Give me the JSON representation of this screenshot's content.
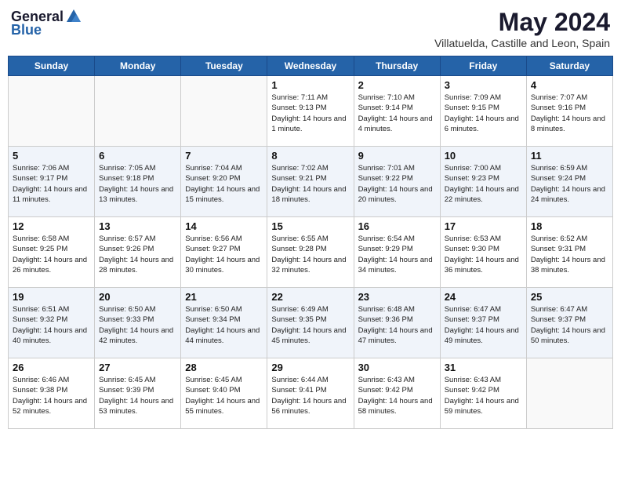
{
  "logo": {
    "general": "General",
    "blue": "Blue"
  },
  "title": "May 2024",
  "location": "Villatuelda, Castille and Leon, Spain",
  "headers": [
    "Sunday",
    "Monday",
    "Tuesday",
    "Wednesday",
    "Thursday",
    "Friday",
    "Saturday"
  ],
  "weeks": [
    [
      {
        "date": "",
        "sunrise": "",
        "sunset": "",
        "daylight": ""
      },
      {
        "date": "",
        "sunrise": "",
        "sunset": "",
        "daylight": ""
      },
      {
        "date": "",
        "sunrise": "",
        "sunset": "",
        "daylight": ""
      },
      {
        "date": "1",
        "sunrise": "Sunrise: 7:11 AM",
        "sunset": "Sunset: 9:13 PM",
        "daylight": "Daylight: 14 hours and 1 minute."
      },
      {
        "date": "2",
        "sunrise": "Sunrise: 7:10 AM",
        "sunset": "Sunset: 9:14 PM",
        "daylight": "Daylight: 14 hours and 4 minutes."
      },
      {
        "date": "3",
        "sunrise": "Sunrise: 7:09 AM",
        "sunset": "Sunset: 9:15 PM",
        "daylight": "Daylight: 14 hours and 6 minutes."
      },
      {
        "date": "4",
        "sunrise": "Sunrise: 7:07 AM",
        "sunset": "Sunset: 9:16 PM",
        "daylight": "Daylight: 14 hours and 8 minutes."
      }
    ],
    [
      {
        "date": "5",
        "sunrise": "Sunrise: 7:06 AM",
        "sunset": "Sunset: 9:17 PM",
        "daylight": "Daylight: 14 hours and 11 minutes."
      },
      {
        "date": "6",
        "sunrise": "Sunrise: 7:05 AM",
        "sunset": "Sunset: 9:18 PM",
        "daylight": "Daylight: 14 hours and 13 minutes."
      },
      {
        "date": "7",
        "sunrise": "Sunrise: 7:04 AM",
        "sunset": "Sunset: 9:20 PM",
        "daylight": "Daylight: 14 hours and 15 minutes."
      },
      {
        "date": "8",
        "sunrise": "Sunrise: 7:02 AM",
        "sunset": "Sunset: 9:21 PM",
        "daylight": "Daylight: 14 hours and 18 minutes."
      },
      {
        "date": "9",
        "sunrise": "Sunrise: 7:01 AM",
        "sunset": "Sunset: 9:22 PM",
        "daylight": "Daylight: 14 hours and 20 minutes."
      },
      {
        "date": "10",
        "sunrise": "Sunrise: 7:00 AM",
        "sunset": "Sunset: 9:23 PM",
        "daylight": "Daylight: 14 hours and 22 minutes."
      },
      {
        "date": "11",
        "sunrise": "Sunrise: 6:59 AM",
        "sunset": "Sunset: 9:24 PM",
        "daylight": "Daylight: 14 hours and 24 minutes."
      }
    ],
    [
      {
        "date": "12",
        "sunrise": "Sunrise: 6:58 AM",
        "sunset": "Sunset: 9:25 PM",
        "daylight": "Daylight: 14 hours and 26 minutes."
      },
      {
        "date": "13",
        "sunrise": "Sunrise: 6:57 AM",
        "sunset": "Sunset: 9:26 PM",
        "daylight": "Daylight: 14 hours and 28 minutes."
      },
      {
        "date": "14",
        "sunrise": "Sunrise: 6:56 AM",
        "sunset": "Sunset: 9:27 PM",
        "daylight": "Daylight: 14 hours and 30 minutes."
      },
      {
        "date": "15",
        "sunrise": "Sunrise: 6:55 AM",
        "sunset": "Sunset: 9:28 PM",
        "daylight": "Daylight: 14 hours and 32 minutes."
      },
      {
        "date": "16",
        "sunrise": "Sunrise: 6:54 AM",
        "sunset": "Sunset: 9:29 PM",
        "daylight": "Daylight: 14 hours and 34 minutes."
      },
      {
        "date": "17",
        "sunrise": "Sunrise: 6:53 AM",
        "sunset": "Sunset: 9:30 PM",
        "daylight": "Daylight: 14 hours and 36 minutes."
      },
      {
        "date": "18",
        "sunrise": "Sunrise: 6:52 AM",
        "sunset": "Sunset: 9:31 PM",
        "daylight": "Daylight: 14 hours and 38 minutes."
      }
    ],
    [
      {
        "date": "19",
        "sunrise": "Sunrise: 6:51 AM",
        "sunset": "Sunset: 9:32 PM",
        "daylight": "Daylight: 14 hours and 40 minutes."
      },
      {
        "date": "20",
        "sunrise": "Sunrise: 6:50 AM",
        "sunset": "Sunset: 9:33 PM",
        "daylight": "Daylight: 14 hours and 42 minutes."
      },
      {
        "date": "21",
        "sunrise": "Sunrise: 6:50 AM",
        "sunset": "Sunset: 9:34 PM",
        "daylight": "Daylight: 14 hours and 44 minutes."
      },
      {
        "date": "22",
        "sunrise": "Sunrise: 6:49 AM",
        "sunset": "Sunset: 9:35 PM",
        "daylight": "Daylight: 14 hours and 45 minutes."
      },
      {
        "date": "23",
        "sunrise": "Sunrise: 6:48 AM",
        "sunset": "Sunset: 9:36 PM",
        "daylight": "Daylight: 14 hours and 47 minutes."
      },
      {
        "date": "24",
        "sunrise": "Sunrise: 6:47 AM",
        "sunset": "Sunset: 9:37 PM",
        "daylight": "Daylight: 14 hours and 49 minutes."
      },
      {
        "date": "25",
        "sunrise": "Sunrise: 6:47 AM",
        "sunset": "Sunset: 9:37 PM",
        "daylight": "Daylight: 14 hours and 50 minutes."
      }
    ],
    [
      {
        "date": "26",
        "sunrise": "Sunrise: 6:46 AM",
        "sunset": "Sunset: 9:38 PM",
        "daylight": "Daylight: 14 hours and 52 minutes."
      },
      {
        "date": "27",
        "sunrise": "Sunrise: 6:45 AM",
        "sunset": "Sunset: 9:39 PM",
        "daylight": "Daylight: 14 hours and 53 minutes."
      },
      {
        "date": "28",
        "sunrise": "Sunrise: 6:45 AM",
        "sunset": "Sunset: 9:40 PM",
        "daylight": "Daylight: 14 hours and 55 minutes."
      },
      {
        "date": "29",
        "sunrise": "Sunrise: 6:44 AM",
        "sunset": "Sunset: 9:41 PM",
        "daylight": "Daylight: 14 hours and 56 minutes."
      },
      {
        "date": "30",
        "sunrise": "Sunrise: 6:43 AM",
        "sunset": "Sunset: 9:42 PM",
        "daylight": "Daylight: 14 hours and 58 minutes."
      },
      {
        "date": "31",
        "sunrise": "Sunrise: 6:43 AM",
        "sunset": "Sunset: 9:42 PM",
        "daylight": "Daylight: 14 hours and 59 minutes."
      },
      {
        "date": "",
        "sunrise": "",
        "sunset": "",
        "daylight": ""
      }
    ]
  ]
}
